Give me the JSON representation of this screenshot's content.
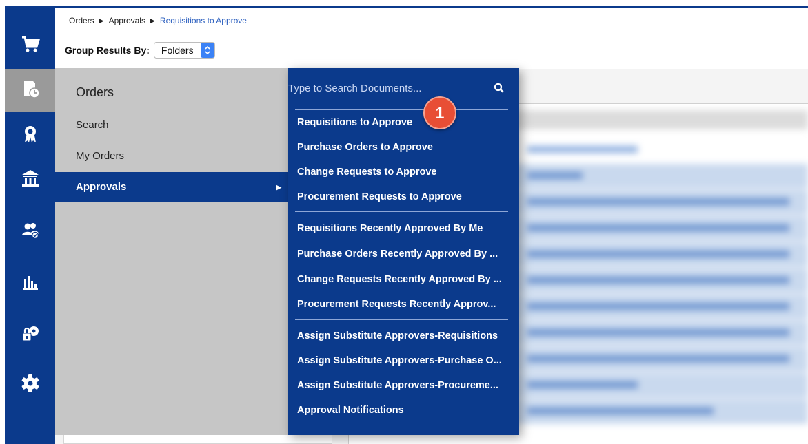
{
  "breadcrumb": {
    "items": [
      "Orders",
      "Approvals",
      "Requisitions to Approve"
    ]
  },
  "group_by": {
    "label": "Group Results By:",
    "value": "Folders"
  },
  "rail": {
    "icons": [
      "cart-icon",
      "orders-history-icon",
      "award-icon",
      "bank-icon",
      "users-icon",
      "reports-icon",
      "admin-lock-icon",
      "settings-gear-icon"
    ],
    "active_index": 1
  },
  "menu": {
    "title": "Orders",
    "items": [
      {
        "label": "Search"
      },
      {
        "label": "My Orders"
      },
      {
        "label": "Approvals",
        "active": true
      }
    ]
  },
  "submenu": {
    "search_placeholder": "Type to Search Documents...",
    "groups": [
      [
        "Requisitions to Approve",
        "Purchase Orders to Approve",
        "Change Requests to Approve",
        "Procurement Requests to Approve"
      ],
      [
        "Requisitions Recently Approved By Me",
        "Purchase Orders Recently Approved By ...",
        "Change Requests Recently Approved By ...",
        "Procurement Requests Recently Approv..."
      ],
      [
        "Assign Substitute Approvers-Requisitions",
        "Assign Substitute Approvers-Purchase O...",
        "Assign Substitute Approvers-Procureme...",
        "Approval Notifications"
      ]
    ]
  },
  "callout": {
    "number": "1"
  },
  "colors": {
    "rail_blue": "#0b3a8c",
    "menu_grey": "#c6c6c6",
    "callout_red": "#e84e35",
    "link_blue": "#2b5fbf"
  }
}
